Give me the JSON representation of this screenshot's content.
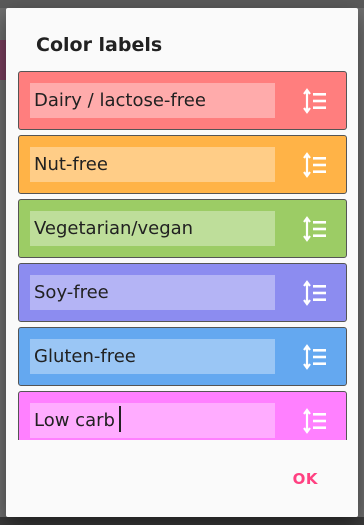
{
  "dialog": {
    "title": "Color labels",
    "ok_label": "OK"
  },
  "labels": [
    {
      "name": "Dairy / lactose-free",
      "color": "#ff7e7e",
      "handle_icon": "reorder-icon"
    },
    {
      "name": "Nut-free",
      "color": "#ffb347",
      "handle_icon": "reorder-icon"
    },
    {
      "name": "Vegetarian/vegan",
      "color": "#9ccc65",
      "handle_icon": "reorder-icon"
    },
    {
      "name": "Soy-free",
      "color": "#8c8cf0",
      "handle_icon": "reorder-icon"
    },
    {
      "name": "Gluten-free",
      "color": "#64a8f0",
      "handle_icon": "reorder-icon"
    },
    {
      "name": "Low carb",
      "color": "#ff80ff",
      "handle_icon": "reorder-icon",
      "focused": true
    }
  ],
  "colors": {
    "accent": "#ff4081",
    "dialog_bg": "#fafafa",
    "scrim": "#6f6f6f"
  }
}
